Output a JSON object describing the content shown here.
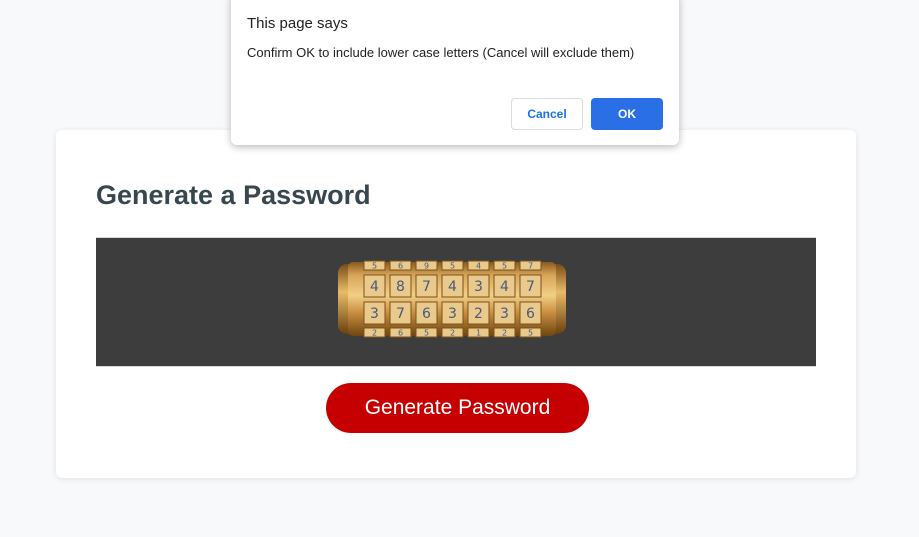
{
  "dialog": {
    "title": "This page says",
    "message": "Confirm OK to include lower case letters (Cancel will exclude them)",
    "cancel_label": "Cancel",
    "ok_label": "OK"
  },
  "card": {
    "title": "Generate a Password",
    "generate_label": "Generate Password",
    "cryptex": {
      "top_row": [
        "5",
        "6",
        "9",
        "5",
        "4",
        "5",
        "7"
      ],
      "row1": [
        "4",
        "8",
        "7",
        "4",
        "3",
        "4",
        "7"
      ],
      "row2": [
        "3",
        "7",
        "6",
        "3",
        "2",
        "3",
        "6"
      ],
      "bottom_row": [
        "2",
        "6",
        "5",
        "2",
        "1",
        "2",
        "5"
      ]
    }
  },
  "colors": {
    "page_bg": "#f8f9fb",
    "title": "#37474f",
    "generate_button": "#c60000",
    "ok_button": "#2a6fe5",
    "image_bg": "#3d3d3d"
  }
}
